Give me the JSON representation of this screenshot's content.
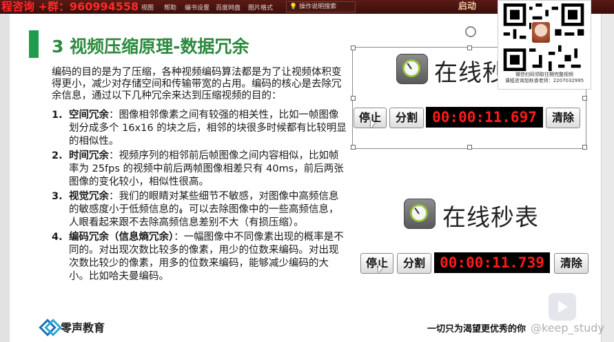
{
  "topbar": {
    "promo_text": "程咨询 +群：960994558",
    "menu": [
      "视图",
      "帮助",
      "编书设置",
      "百度网盘",
      "图片格式"
    ],
    "search_label": "操作说明搜索",
    "right_fragment": "启动"
  },
  "slide": {
    "title": "3  视频压缩原理-数据冗余",
    "intro": "编码的目的是为了压缩，各种视频编码算法都是为了让视频体积变得更小，减少对存储空间和传输带宽的占用。编码的核心是去除冗余信息，通过以下几种冗余来达到压缩视频的目的：",
    "items": [
      {
        "num": "1.",
        "term": "空间冗余",
        "text": "：图像相邻像素之间有较强的相关性，比如一帧图像划分成多个 16x16 的块之后，相邻的块很多时候都有比较明显的相似性。"
      },
      {
        "num": "2.",
        "term": "时间冗余",
        "text": "：视频序列的相邻前后帧图像之间内容相似，比如帧率为 25fps 的视频中前后两帧图像相差只有 40ms，前后两张图像的变化较小，相似性很高。"
      },
      {
        "num": "3.",
        "term": "视觉冗余",
        "text": "：我们的眼睛对某些细节不敏感，对图像中高频信息的敏感度小于低频信息的。可以去除图像中的一些高频信息，人眼看起来跟不去除高频信息差别不大（有损压缩）。"
      },
      {
        "num": "4.",
        "term": "编码冗余（信息熵冗余）",
        "text": "：一幅图像中不同像素出现的概率是不同的。对出现次数比较多的像素，用少的位数来编码。对出现次数比较少的像素，用多的位数来编码，能够减少编码的大小。比如哈夫曼编码。"
      }
    ],
    "footer_logo": "零声教育",
    "footer_slogan": "一切只为渴望更优秀的你",
    "watermark": "@keep_study",
    "stopwatch1": {
      "title": "在线秒",
      "stop": "停止",
      "split": "分割",
      "time": "00:00:11.697",
      "clear": "清除"
    },
    "stopwatch2": {
      "title": "在线秒表",
      "stop": "停止",
      "split": "分割",
      "time": "00:00:11.739",
      "clear": "清除"
    }
  },
  "qr": {
    "caption_line1": "微信扫码领取往期完整视频",
    "caption_line2": "课程咨询加秋香老师：2207032995"
  }
}
